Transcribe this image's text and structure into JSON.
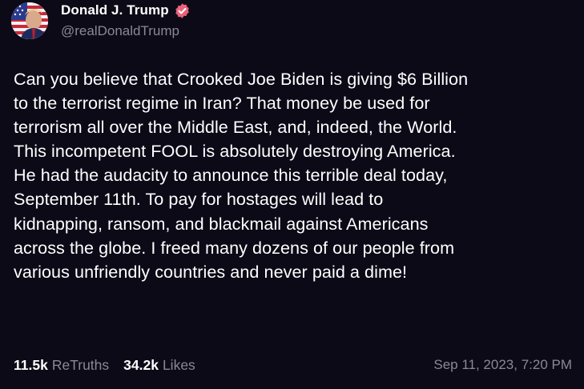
{
  "author": {
    "display_name": "Donald J. Trump",
    "handle": "@realDonaldTrump",
    "verified": true,
    "avatar_icon": "profile-photo-flag",
    "verified_icon": "verified-badge-icon",
    "verified_color": "#e8637a"
  },
  "post": {
    "lines": [
      "Can you believe that Crooked Joe Biden is giving $6 Billion",
      "to the terrorist regime in Iran? That money be used for",
      "terrorism all over the Middle East, and, indeed, the World.",
      "This incompetent FOOL is absolutely destroying America.",
      "He had the audacity to announce this terrible deal today,",
      "September 11th. To pay for hostages will lead to",
      "kidnapping, ransom, and blackmail against Americans",
      "across the globe. I freed many dozens of our people from",
      "various unfriendly countries and never paid a dime!"
    ]
  },
  "stats": {
    "retruths_count": "11.5k",
    "retruths_label": "ReTruths",
    "likes_count": "34.2k",
    "likes_label": "Likes"
  },
  "timestamp": "Sep 11, 2023, 7:20 PM",
  "colors": {
    "background": "#0d0a17",
    "text": "#ffffff",
    "muted": "#8b8797"
  }
}
